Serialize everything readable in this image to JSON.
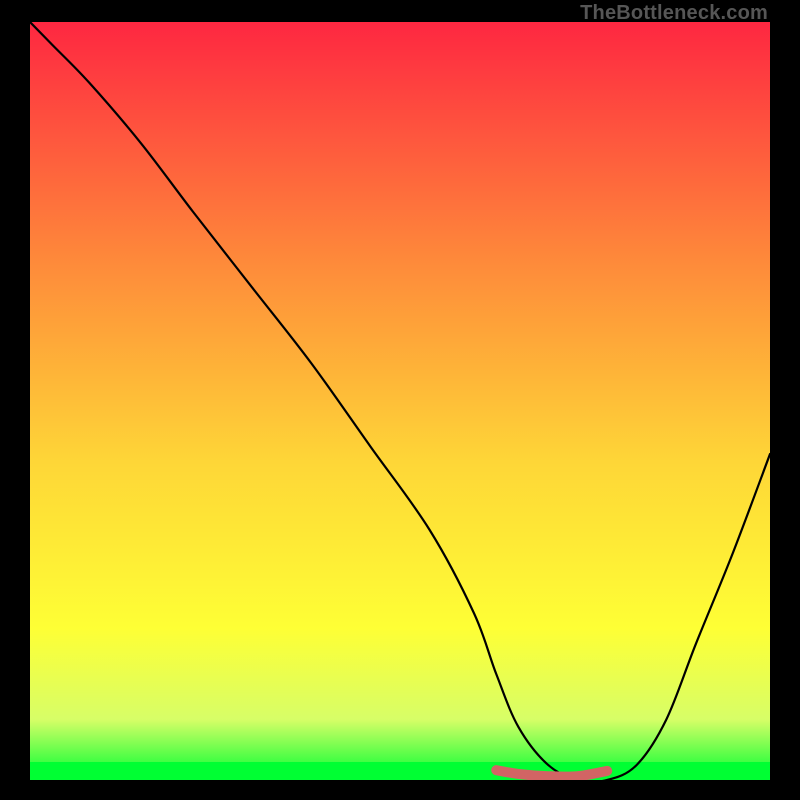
{
  "watermark": "TheBottleneck.com",
  "colors": {
    "gradient_top": "#fe2741",
    "gradient_mid1": "#fe8b3a",
    "gradient_mid2": "#fed637",
    "gradient_mid3": "#feff35",
    "gradient_bottom_band": "#d7fe67",
    "gradient_bottom": "#00ff33",
    "curve": "#000000",
    "bottom_mark": "#d26464"
  },
  "chart_data": {
    "type": "line",
    "title": "",
    "xlabel": "",
    "ylabel": "",
    "xlim": [
      0,
      100
    ],
    "ylim": [
      0,
      100
    ],
    "series": [
      {
        "name": "curve",
        "x": [
          0,
          3,
          8,
          15,
          22,
          30,
          38,
          46,
          54,
          60,
          63,
          66,
          70,
          74,
          78,
          82,
          86,
          90,
          95,
          100
        ],
        "y": [
          100,
          97,
          92,
          84,
          75,
          65,
          55,
          44,
          33,
          22,
          14,
          7,
          2,
          0,
          0,
          2,
          8,
          18,
          30,
          43
        ]
      },
      {
        "name": "min-band",
        "x": [
          63,
          66,
          70,
          74,
          78
        ],
        "y": [
          1.3,
          0.8,
          0.5,
          0.5,
          1.2
        ]
      }
    ]
  }
}
